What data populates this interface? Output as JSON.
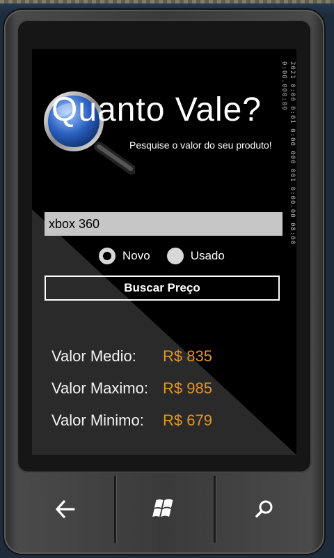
{
  "app": {
    "title": "Quanto Vale?",
    "subtitle": "Pesquise o valor do seu produto!"
  },
  "status_strip": {
    "text": "2021 0:00  0:01 0:00  000 001  0:00.00 08:00 0:00.000:00"
  },
  "search": {
    "value": "xbox 360",
    "placeholder": ""
  },
  "condition": {
    "options": [
      {
        "label": "Novo",
        "checked": true
      },
      {
        "label": "Usado",
        "checked": false
      }
    ]
  },
  "search_button": {
    "label": "Buscar Preço"
  },
  "results": [
    {
      "label": "Valor Medio:",
      "value": "R$ 835"
    },
    {
      "label": "Valor Maximo:",
      "value": "R$ 985"
    },
    {
      "label": "Valor Minimo:",
      "value": "R$ 679"
    }
  ],
  "hardware_buttons": [
    "back-arrow-icon",
    "windows-logo-icon",
    "search-icon"
  ],
  "colors": {
    "accent": "#e4932a",
    "screen_background": "#000000",
    "input_background": "#c6c6c6"
  }
}
